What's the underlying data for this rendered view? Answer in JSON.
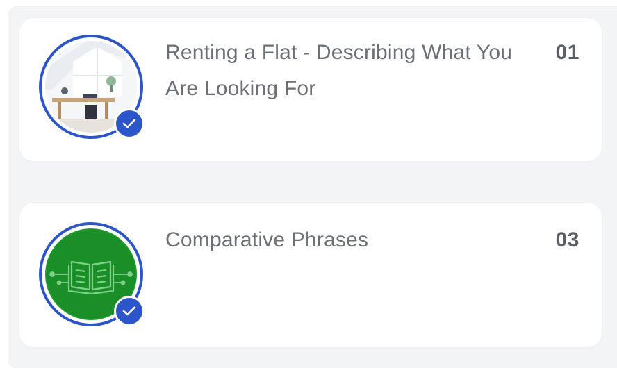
{
  "lessons": [
    {
      "title": "Renting a Flat - Describing What You Are Looking For",
      "number": "01",
      "completed": true,
      "thumbnail": "room-interior-image",
      "status_icon": "check-icon"
    },
    {
      "title": "Comparative Phrases",
      "number": "03",
      "completed": true,
      "thumbnail": "book-circuit-image",
      "status_icon": "check-icon"
    }
  ],
  "colors": {
    "accent": "#2b55c8",
    "title_text": "#6b6f76",
    "number_text": "#5b5f66",
    "card_bg": "#ffffff",
    "panel_bg": "#f3f4f6",
    "thumbnail_green": "#1e9a2c"
  }
}
